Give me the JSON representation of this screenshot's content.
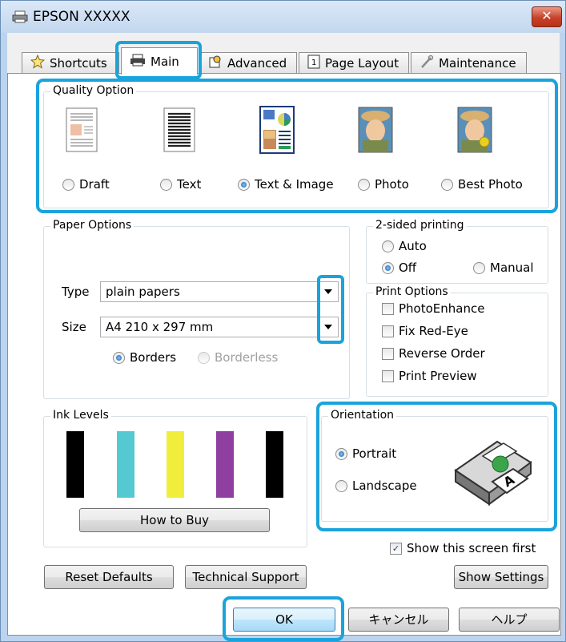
{
  "window": {
    "title": "EPSON XXXXX",
    "close_symbol": "✕"
  },
  "tabs": [
    {
      "label": "Shortcuts",
      "icon": "star-icon"
    },
    {
      "label": "Main",
      "icon": "printer-icon"
    },
    {
      "label": "Advanced",
      "icon": "advanced-icon"
    },
    {
      "label": "Page Layout",
      "icon": "page-layout-icon"
    },
    {
      "label": "Maintenance",
      "icon": "wrench-icon"
    }
  ],
  "quality": {
    "title": "Quality Option",
    "options": [
      {
        "label": "Draft",
        "selected": false
      },
      {
        "label": "Text",
        "selected": false
      },
      {
        "label": "Text & Image",
        "selected": true
      },
      {
        "label": "Photo",
        "selected": false
      },
      {
        "label": "Best Photo",
        "selected": false
      }
    ]
  },
  "paper": {
    "title": "Paper Options",
    "type_label": "Type",
    "type_value": "plain papers",
    "size_label": "Size",
    "size_value": "A4 210 x 297 mm",
    "borders": "Borders",
    "borderless": "Borderless"
  },
  "two_sided": {
    "title": "2-sided printing",
    "auto": "Auto",
    "off": "Off",
    "manual": "Manual"
  },
  "print_options": {
    "title": "Print Options",
    "items": [
      "PhotoEnhance",
      "Fix Red-Eye",
      "Reverse Order",
      "Print Preview"
    ]
  },
  "ink": {
    "title": "Ink Levels",
    "colors": [
      "#000000",
      "#55c9d2",
      "#f0ee3a",
      "#8e3fa0",
      "#000000"
    ],
    "how_to_buy": "How to Buy"
  },
  "orientation": {
    "title": "Orientation",
    "portrait": "Portrait",
    "landscape": "Landscape"
  },
  "show_first": {
    "label": "Show this screen first",
    "checked": true
  },
  "buttons": {
    "reset": "Reset Defaults",
    "support": "Technical Support",
    "show_settings": "Show Settings",
    "ok": "OK",
    "cancel": "キャンセル",
    "help": "ヘルプ"
  },
  "highlight_color": "#1aa3dc"
}
